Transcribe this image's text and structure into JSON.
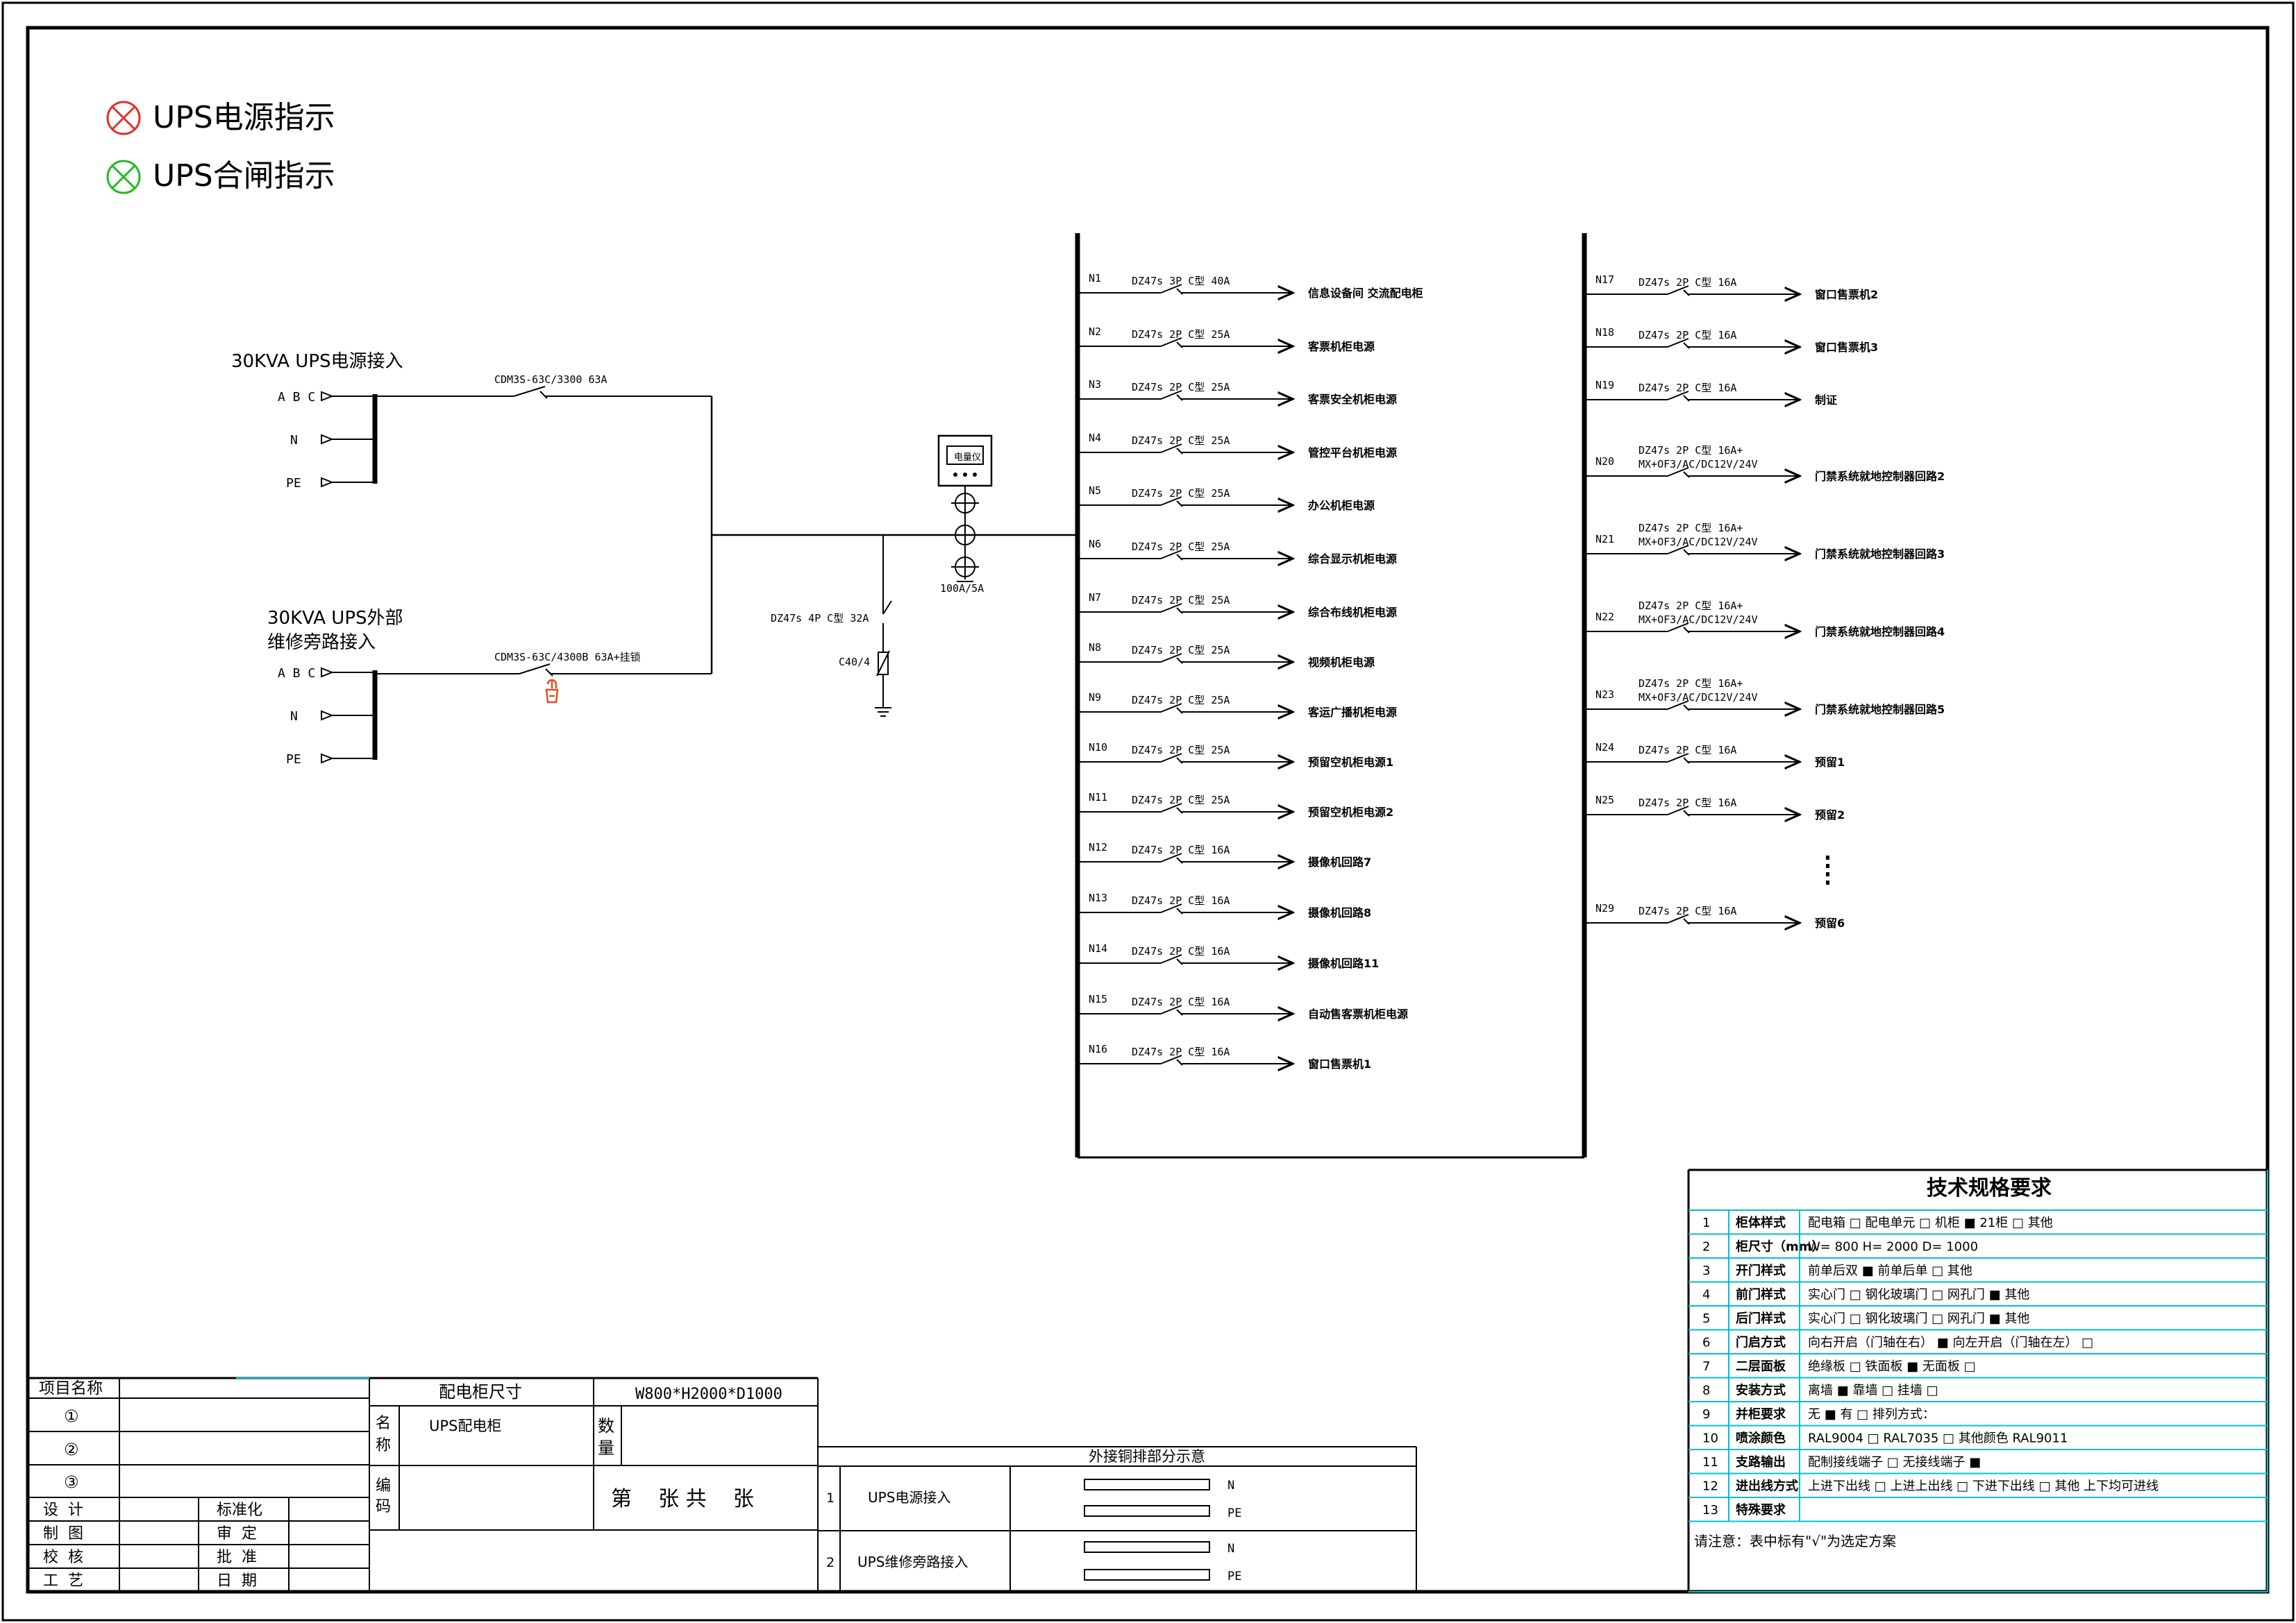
{
  "legend": [
    {
      "label": "UPS电源指示",
      "color": "#e0302a"
    },
    {
      "label": "UPS合闸指示",
      "color": "#28b828"
    }
  ],
  "inputs": {
    "main": {
      "title": "30KVA UPS电源接入",
      "terminals": [
        "A B C",
        "N",
        "PE"
      ],
      "breaker": "CDM3S-63C/3300 63A"
    },
    "bypass": {
      "title_line1": "30KVA UPS外部",
      "title_line2": "维修旁路接入",
      "terminals": [
        "A B C",
        "N",
        "PE"
      ],
      "breaker": "CDM3S-63C/4300B 63A+挂锁"
    }
  },
  "surge": {
    "breaker": "DZ47s 4P C型 32A",
    "spd": "C40/4"
  },
  "meter": {
    "label": "电量仪",
    "ct": "100A/5A"
  },
  "left_circuits": [
    {
      "id": "N1",
      "spec": "DZ47s 3P C型 40A",
      "load": "信息设备间 交流配电柜"
    },
    {
      "id": "N2",
      "spec": "DZ47s 2P C型 25A",
      "load": "客票机柜电源"
    },
    {
      "id": "N3",
      "spec": "DZ47s 2P C型 25A",
      "load": "客票安全机柜电源"
    },
    {
      "id": "N4",
      "spec": "DZ47s 2P C型 25A",
      "load": "管控平台机柜电源"
    },
    {
      "id": "N5",
      "spec": "DZ47s 2P C型 25A",
      "load": "办公机柜电源"
    },
    {
      "id": "N6",
      "spec": "DZ47s 2P C型 25A",
      "load": "综合显示机柜电源"
    },
    {
      "id": "N7",
      "spec": "DZ47s 2P C型 25A",
      "load": "综合布线机柜电源"
    },
    {
      "id": "N8",
      "spec": "DZ47s 2P C型 25A",
      "load": "视频机柜电源"
    },
    {
      "id": "N9",
      "spec": "DZ47s 2P C型 25A",
      "load": "客运广播机柜电源"
    },
    {
      "id": "N10",
      "spec": "DZ47s 2P C型 25A",
      "load": "预留空机柜电源1"
    },
    {
      "id": "N11",
      "spec": "DZ47s 2P C型 25A",
      "load": "预留空机柜电源2"
    },
    {
      "id": "N12",
      "spec": "DZ47s 2P C型 16A",
      "load": "摄像机回路7"
    },
    {
      "id": "N13",
      "spec": "DZ47s 2P C型 16A",
      "load": "摄像机回路8"
    },
    {
      "id": "N14",
      "spec": "DZ47s 2P C型 16A",
      "load": "摄像机回路11"
    },
    {
      "id": "N15",
      "spec": "DZ47s 2P C型 16A",
      "load": "自动售客票机柜电源"
    },
    {
      "id": "N16",
      "spec": "DZ47s 2P C型 16A",
      "load": "窗口售票机1"
    }
  ],
  "right_circuits": [
    {
      "id": "N17",
      "spec": "DZ47s 2P C型 16A",
      "spec2": "",
      "load": "窗口售票机2"
    },
    {
      "id": "N18",
      "spec": "DZ47s 2P C型 16A",
      "spec2": "",
      "load": "窗口售票机3"
    },
    {
      "id": "N19",
      "spec": "DZ47s 2P C型 16A",
      "spec2": "",
      "load": "制证"
    },
    {
      "id": "N20",
      "spec": "DZ47s 2P C型 16A+",
      "spec2": "MX+OF3/AC/DC12V/24V",
      "load": "门禁系统就地控制器回路2"
    },
    {
      "id": "N21",
      "spec": "DZ47s 2P C型 16A+",
      "spec2": "MX+OF3/AC/DC12V/24V",
      "load": "门禁系统就地控制器回路3"
    },
    {
      "id": "N22",
      "spec": "DZ47s 2P C型 16A+",
      "spec2": "MX+OF3/AC/DC12V/24V",
      "load": "门禁系统就地控制器回路4"
    },
    {
      "id": "N23",
      "spec": "DZ47s 2P C型 16A+",
      "spec2": "MX+OF3/AC/DC12V/24V",
      "load": "门禁系统就地控制器回路5"
    },
    {
      "id": "N24",
      "spec": "DZ47s 2P C型 16A",
      "spec2": "",
      "load": "预留1"
    },
    {
      "id": "N25",
      "spec": "DZ47s 2P C型 16A",
      "spec2": "",
      "load": "预留2"
    },
    {
      "id": "N29",
      "spec": "DZ47s 2P C型 16A",
      "spec2": "",
      "load": "预留6"
    }
  ],
  "spec_table": {
    "title": "技术规格要求",
    "rows": [
      {
        "no": "1",
        "name": "柜体样式",
        "content": "配电箱 □   配电单元 □      机柜  ■   21柜 □   其他"
      },
      {
        "no": "2",
        "name": "柜尺寸（mm）",
        "content": "W=   800     H=   2000    D=   1000"
      },
      {
        "no": "3",
        "name": "开门样式",
        "content": "前单后双 ■      前单后单 □       其他"
      },
      {
        "no": "4",
        "name": "前门样式",
        "content": "实心门   □   钢化玻璃门 □     网孔门 ■    其他"
      },
      {
        "no": "5",
        "name": "后门样式",
        "content": "实心门   □   钢化玻璃门 □     网孔门 ■    其他"
      },
      {
        "no": "6",
        "name": "门启方式",
        "content": "向右开启（门轴在右）   ■    向左开启（门轴在左） □"
      },
      {
        "no": "7",
        "name": "二层面板",
        "content": "绝缘板    □      铁面板 ■      无面板 □"
      },
      {
        "no": "8",
        "name": "安装方式",
        "content": "离墙      ■       靠墙    □        挂墙    □"
      },
      {
        "no": "9",
        "name": "并柜要求",
        "content": "无      ■          有  □  排列方式："
      },
      {
        "no": "10",
        "name": "喷涂颜色",
        "content": "RAL9004  □        RAL7035    □ 其他颜色     RAL9011"
      },
      {
        "no": "11",
        "name": "支路输出",
        "content": "配制接线端子  □    无接线端子  ■"
      },
      {
        "no": "12",
        "name": "进出线方式",
        "content": "上进下出线     □  上进上出线   □    下进下出线    □       其他  上下均可进线"
      },
      {
        "no": "13",
        "name": "特殊要求",
        "content": ""
      }
    ],
    "note": "请注意：表中标有\"√\"为选定方案"
  },
  "title_block": {
    "project_name_label": "项目名称",
    "circled": [
      "①",
      "②",
      "③"
    ],
    "role_labels": [
      "设  计",
      "制  图",
      "校  核",
      "工  艺"
    ],
    "approval_labels": [
      "标准化",
      "审  定",
      "批  准",
      "日  期"
    ],
    "cabinet_size_label": "配电柜尺寸",
    "cabinet_size_value": "W800*H2000*D1000",
    "name_label": "名称",
    "name_value": "UPS配电柜",
    "qty_label": "数量",
    "code_label": "编码",
    "sheet_label": "第    张 共    张"
  },
  "copper_bar": {
    "title": "外接铜排部分示意",
    "rows": [
      {
        "no": "1",
        "label": "UPS电源接入",
        "n": "N",
        "pe": "PE"
      },
      {
        "no": "2",
        "label": "UPS维修旁路接入",
        "n": "N",
        "pe": "PE"
      }
    ]
  }
}
